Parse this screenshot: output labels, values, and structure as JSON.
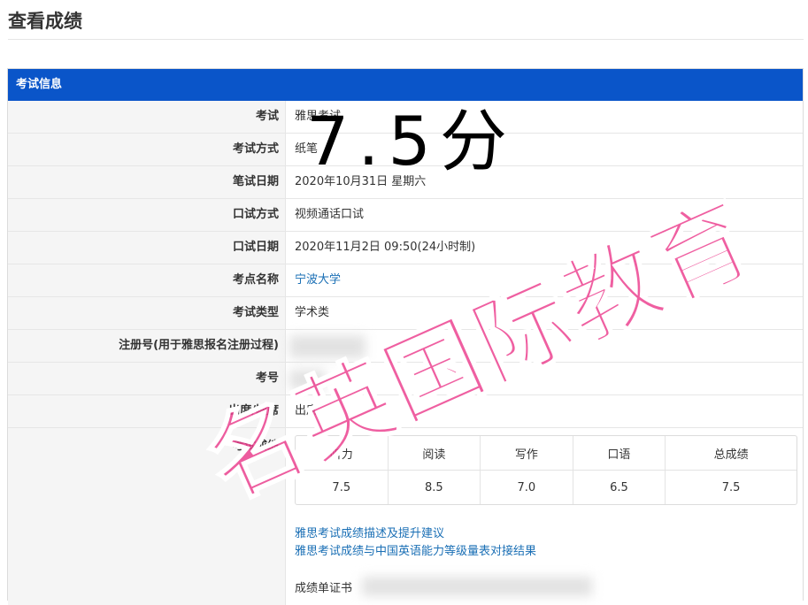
{
  "page": {
    "title": "查看成绩"
  },
  "panel": {
    "header": "考试信息"
  },
  "rows": [
    {
      "label": "考试",
      "value": "雅思考试"
    },
    {
      "label": "考试方式",
      "value": "纸笔"
    },
    {
      "label": "笔试日期",
      "value": "2020年10月31日 星期六"
    },
    {
      "label": "口试方式",
      "value": "视频通话口试"
    },
    {
      "label": "口试日期",
      "value": "2020年11月2日 09:50(24小时制)"
    },
    {
      "label": "考点名称",
      "value": "宁波大学"
    },
    {
      "label": "考试类型",
      "value": "学术类"
    },
    {
      "label": "注册号(用于雅思报名注册过程)",
      "value": ""
    },
    {
      "label": "考号",
      "value": ""
    },
    {
      "label": "出席/缺席",
      "value": "出席"
    }
  ],
  "scores": {
    "label": "考试成绩",
    "headers": [
      "听力",
      "阅读",
      "写作",
      "口语",
      "总成绩"
    ],
    "values": [
      "7.5",
      "8.5",
      "7.0",
      "6.5",
      "7.5"
    ]
  },
  "links": {
    "describe": "雅思考试成绩描述及提升建议",
    "cse": "雅思考试成绩与中国英语能力等级量表对接结果"
  },
  "report": {
    "label": "成绩单证书"
  },
  "overlay": {
    "score_text": "7.5分",
    "watermark": "名英国际教育",
    "watermark_color": "#eb3c8c"
  },
  "colors": {
    "header_bg": "#0a55c9",
    "link": "#1a6fb5"
  }
}
